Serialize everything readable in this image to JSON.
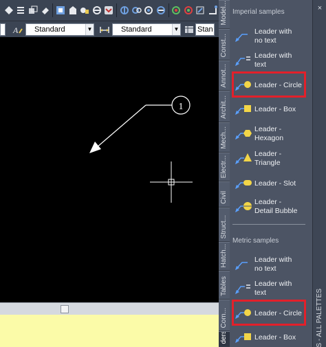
{
  "toolbar2": {
    "text_style": "Standard",
    "dim_style": "Standard",
    "table_style_partial": "Stan"
  },
  "drawing": {
    "balloon_number": "1"
  },
  "palette_tabs": [
    {
      "label": "Model..."
    },
    {
      "label": "Const..."
    },
    {
      "label": "Annot..."
    },
    {
      "label": "Archit..."
    },
    {
      "label": "Mech..."
    },
    {
      "label": "Electr..."
    },
    {
      "label": "Civil"
    },
    {
      "label": "Struct..."
    },
    {
      "label": "Hatch..."
    },
    {
      "label": "Tables"
    },
    {
      "label": "Com..."
    },
    {
      "label": "ders"
    }
  ],
  "palette": {
    "imperial_header": "Imperial samples",
    "metric_header": "Metric samples",
    "imperial_tools": [
      {
        "line1": "Leader with",
        "line2": "no text"
      },
      {
        "line1": "Leader with",
        "line2": "text"
      },
      {
        "line1": "Leader - Circle",
        "line2": ""
      },
      {
        "line1": "Leader - Box",
        "line2": ""
      },
      {
        "line1": "Leader -",
        "line2": "Hexagon"
      },
      {
        "line1": "Leader -",
        "line2": "Triangle"
      },
      {
        "line1": "Leader - Slot",
        "line2": ""
      },
      {
        "line1": "Leader -",
        "line2": "Detail Bubble"
      }
    ],
    "metric_tools": [
      {
        "line1": "Leader with",
        "line2": "no text"
      },
      {
        "line1": "Leader with",
        "line2": "text"
      },
      {
        "line1": "Leader - Circle",
        "line2": ""
      },
      {
        "line1": "Leader - Box",
        "line2": ""
      }
    ]
  },
  "strip": {
    "close": "×",
    "title": "S - ALL PALETTES"
  },
  "colors": {
    "highlight": "#e3202a",
    "palette_bg": "#4c5464",
    "command_line": "#fbfba8"
  }
}
